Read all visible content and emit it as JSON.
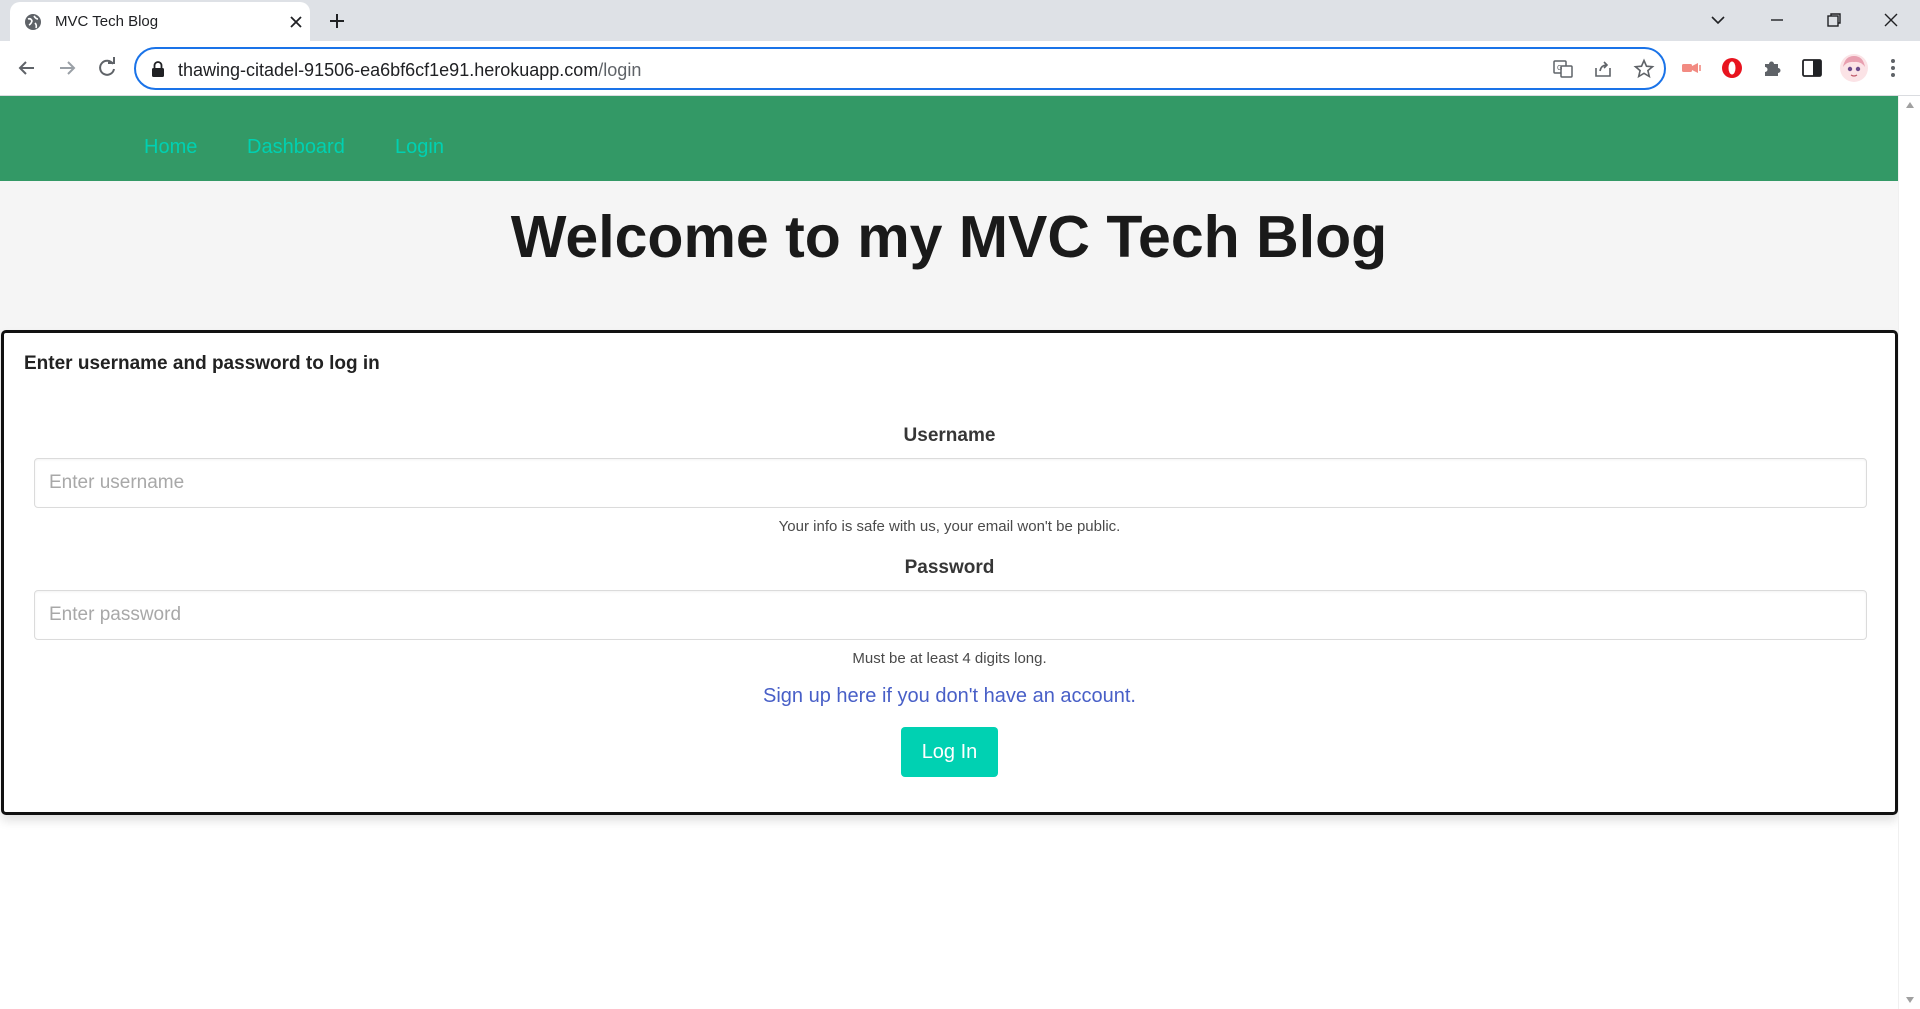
{
  "browser": {
    "tab_title": "MVC Tech Blog",
    "url_host": "thawing-citadel-91506-ea6bf6cf1e91.herokuapp.com",
    "url_path": "/login"
  },
  "nav": {
    "home": "Home",
    "dashboard": "Dashboard",
    "login": "Login"
  },
  "hero": {
    "title": "Welcome to my MVC Tech Blog"
  },
  "login_form": {
    "heading": "Enter username and password to log in",
    "username_label": "Username",
    "username_placeholder": "Enter username",
    "username_help": "Your info is safe with us, your email won't be public.",
    "password_label": "Password",
    "password_placeholder": "Enter password",
    "password_help": "Must be at least 4 digits long.",
    "signup_link": "Sign up here if you don't have an account.",
    "submit_label": "Log In"
  },
  "colors": {
    "nav_background": "#339966",
    "nav_link": "#00d1b2",
    "primary_button": "#00d1b2",
    "link": "#485fc7",
    "focus_ring": "#1a73e8"
  },
  "icons": [
    "globe-icon",
    "close-icon",
    "plus-icon",
    "chevron-down-icon",
    "minimize-icon",
    "restore-icon",
    "window-close-icon",
    "back-icon",
    "forward-icon",
    "reload-icon",
    "lock-icon",
    "translate-icon",
    "share-icon",
    "star-icon",
    "extension-cast-icon",
    "opera-icon",
    "puzzle-icon",
    "side-panel-icon",
    "avatar",
    "kebab-menu-icon"
  ]
}
